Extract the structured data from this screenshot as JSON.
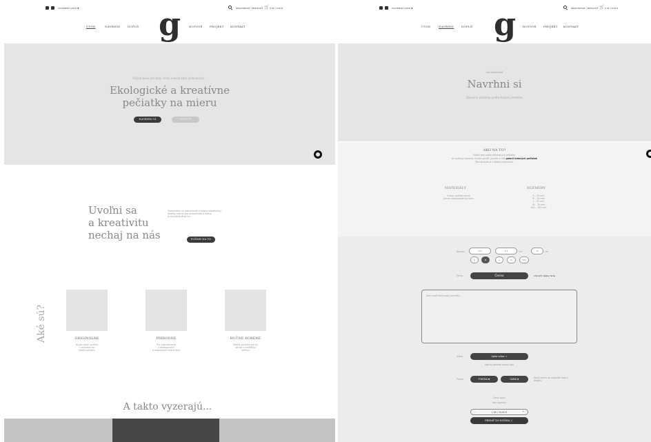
{
  "topbar": {
    "lang": "SLOVENSKÝ JAZYK ▼",
    "account": "REGISTROVAŤ / PRIHLÁSIŤ",
    "cart": "0 KS / 0,00 €"
  },
  "nav": {
    "items": [
      "ÚVOD",
      "NAVRHNI",
      "DOPLŇ",
      "HOTOVÉ",
      "PROJEKT",
      "KONTAKT"
    ],
    "logo": "g"
  },
  "left": {
    "hero": {
      "subtitle": "Objednávka pečiatky nikdy nebola taká jednoduchá...",
      "title_line1": "Ekologické a kreatívne",
      "title_line2": "pečiatky na mieru",
      "btn_primary": "NAVRHNI SI",
      "btn_secondary": "HOTOVÉ"
    },
    "intro": {
      "heading_line1": "Uvoľni sa",
      "heading_line2": "a kreativitu",
      "heading_line3": "nechaj na nás",
      "text_line1": "Pomocníkov na jednoduché a krásne objednávky",
      "text_line2": "Ideálny nástroj pre rozhodnutie a nákup",
      "text_line3": "aj od počiatočnej iny.",
      "button": "POĎME NA TO"
    },
    "features": {
      "side_heading": "Aké sú?",
      "items": [
        {
          "title": "ORIGINÁLNE",
          "line1": "Dizajn ktorý vznikne",
          "line2": "s ohľadom na",
          "line3": "každú pečiatku"
        },
        {
          "title": "PRÍRODNÉ",
          "line1": "Pre rozbudovanie",
          "line2": "z ekologických",
          "line3": "a odpadových materiálov"
        },
        {
          "title": "RUČNE ROBENÉ",
          "line1": "Každá pečiatka pre jej",
          "line2": "vzniká s najväčšou",
          "line3": "vášňou"
        }
      ]
    },
    "gallery": {
      "heading": "A takto vyzerajú..."
    }
  },
  "right": {
    "hero": {
      "breadcrumb": "Ako objednávať",
      "title": "Navrhni si",
      "subtitle": "Drevená pečiatka podľa tvojich predstáv"
    },
    "how": {
      "heading": "AKO NA TO?",
      "line1": "Vložte text alebo obrázok pre pečiatku.",
      "line2_pre": "Ak vybraný obrázok chcete použiť, pozrite si náš ",
      "line2_bold": "galerii hotových pečiatok",
      "line3": "Táto stránka je v štádiu testovania."
    },
    "materials": {
      "heading": "MATERIÁLY",
      "line1": "Drevo, bukové drevo",
      "line2": "jemne opracované do tvaru"
    },
    "sizes": {
      "heading": "ROZMERY",
      "rows": [
        "S – 30 mm",
        "M – 40 mm",
        "L – 50 mm",
        "XL – 70 mm",
        "XXL – 100 mm"
      ]
    },
    "configurator": {
      "size_label": "Rozmer",
      "size_value1": "2,5",
      "size_value2": "3,5",
      "size_value3": "11",
      "size_unit": "cm",
      "size_options": [
        "S",
        "M",
        "L",
        "XL",
        "XXL"
      ],
      "color_label": "Farba",
      "color_value": "Čierna",
      "color_link": "zobraziť všetky farby",
      "textarea_placeholder": "Sem napíš text svojej pečiatky...",
      "file_label": "Súbor",
      "file_button": "Vyber súbor",
      "file_hint": "Nahraj obrázok alebo logo",
      "font_label": "Písmo",
      "font_value": "FONTNA",
      "style_value": "SAMA",
      "note": "Ktoré písmo sa najlepšie hodí k dizajnu",
      "price_label": "Cena spolu",
      "price_sub": "bez dopravy",
      "qty_minus": "-",
      "qty_value": "1 KS / 10,00 €",
      "qty_plus": "+",
      "add_to_cart": "PRIDAŤ DO KOŠÍKA"
    }
  }
}
